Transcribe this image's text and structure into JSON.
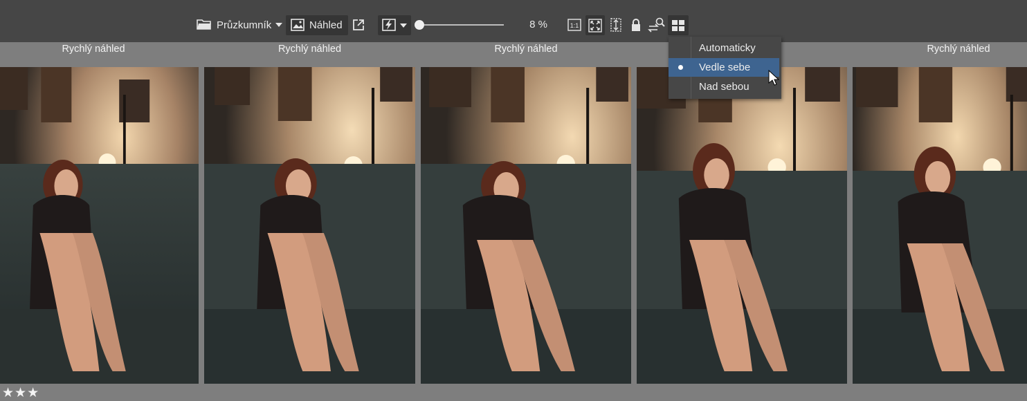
{
  "toolbar": {
    "explorer_label": "Průzkumník",
    "preview_label": "Náhled",
    "zoom_value": "8 %",
    "zoom_level": 0.08,
    "icons": [
      "folder-icon",
      "chevron-down-icon",
      "image-icon",
      "external-open-icon",
      "flash-icon",
      "chevron-down-icon",
      "actual-size-icon",
      "fit-screen-icon",
      "fit-height-icon",
      "lock-icon",
      "compare-swap-icon",
      "layout-grid-icon"
    ],
    "one_to_one": "1:1"
  },
  "photos": [
    {
      "caption": "Rychlý náhled"
    },
    {
      "caption": "Rychlý náhled"
    },
    {
      "caption": "Rychlý náhled"
    },
    {
      "caption": ""
    },
    {
      "caption": "Rychlý náhled"
    }
  ],
  "layout_menu": {
    "items": [
      {
        "label": "Automaticky",
        "selected": false
      },
      {
        "label": "Vedle sebe",
        "selected": true
      },
      {
        "label": "Nad sebou",
        "selected": false
      }
    ]
  },
  "rating": {
    "stars": 3,
    "text": "★★★"
  },
  "colors": {
    "toolbar": "#464646",
    "background": "#7e7e7e",
    "menu_highlight": "#3e6490"
  }
}
